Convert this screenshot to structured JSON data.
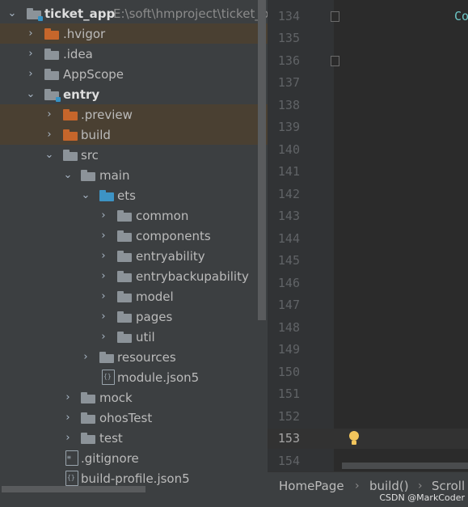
{
  "project_tree": {
    "root_name": "ticket_app",
    "root_path": "E:\\soft\\hmproject\\ticket_p",
    "items": [
      {
        "label": "ticket_app",
        "path": "E:\\soft\\hmproject\\ticket_p"
      },
      {
        "label": ".hvigor"
      },
      {
        "label": ".idea"
      },
      {
        "label": "AppScope"
      },
      {
        "label": "entry"
      },
      {
        "label": ".preview"
      },
      {
        "label": "build"
      },
      {
        "label": "src"
      },
      {
        "label": "main"
      },
      {
        "label": "ets"
      },
      {
        "label": "common"
      },
      {
        "label": "components"
      },
      {
        "label": "entryability"
      },
      {
        "label": "entrybackupability"
      },
      {
        "label": "model"
      },
      {
        "label": "pages"
      },
      {
        "label": "util"
      },
      {
        "label": "resources"
      },
      {
        "label": "module.json5"
      },
      {
        "label": "mock"
      },
      {
        "label": "ohosTest"
      },
      {
        "label": "test"
      },
      {
        "label": ".gitignore"
      },
      {
        "label": "build-profile.json5"
      }
    ]
  },
  "editor": {
    "line_numbers": [
      "134",
      "135",
      "136",
      "137",
      "138",
      "139",
      "140",
      "141",
      "142",
      "143",
      "144",
      "145",
      "146",
      "147",
      "148",
      "149",
      "150",
      "151",
      "152",
      "153",
      "154"
    ],
    "current_line": "153",
    "code_fragment": "Co"
  },
  "breadcrumbs": [
    "HomePage",
    "build()",
    "Scroll"
  ],
  "watermark": "CSDN @MarkCoder",
  "colors": {
    "panel_bg": "#3c3f41",
    "editor_bg": "#2b2b2b",
    "excluded_folder": "#c6662b",
    "source_folder": "#3d93c4",
    "normal_folder": "#8c9399",
    "excluded_row_bg": "#4a4032"
  }
}
